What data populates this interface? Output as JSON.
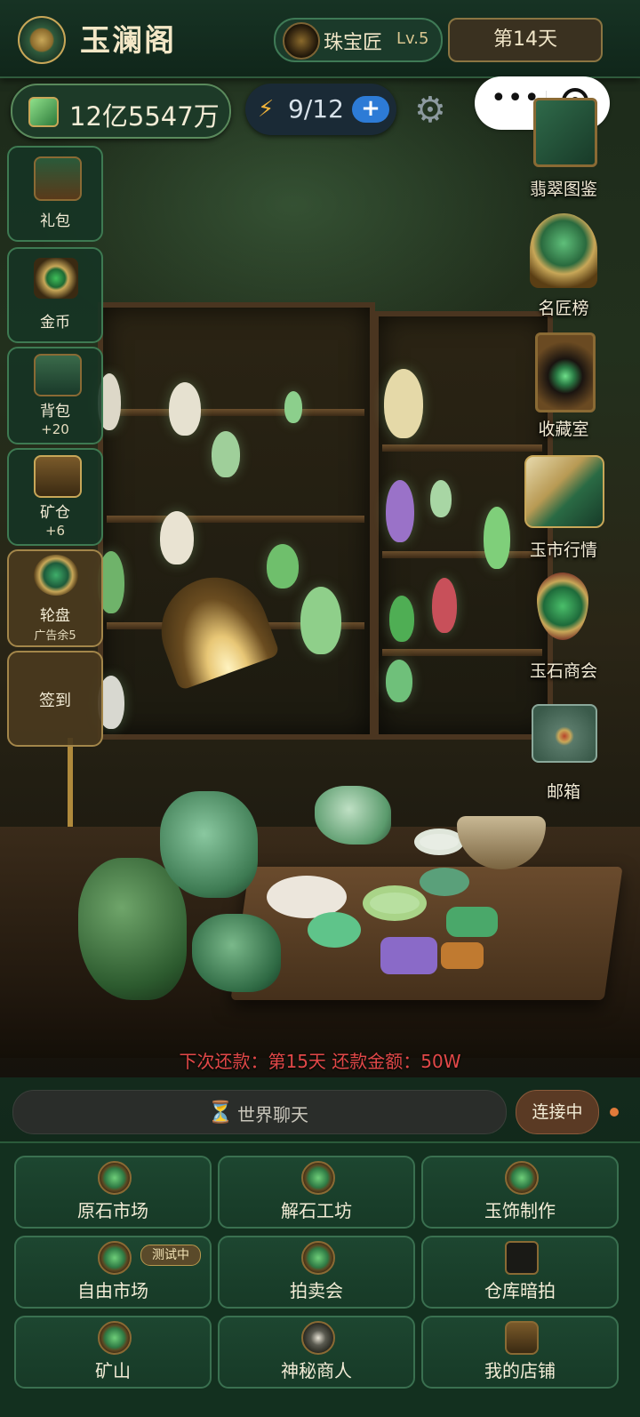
{
  "header": {
    "app_title": "玉澜阁",
    "rank_title": "珠宝匠",
    "rank_level": "Lv.5",
    "day_label": "第14天"
  },
  "resources": {
    "money": "12亿5547万",
    "energy": "9/12",
    "energy_add_symbol": "+"
  },
  "left_sidebar": [
    {
      "label": "礼包",
      "sub": ""
    },
    {
      "label": "金币",
      "sub": ""
    },
    {
      "label": "背包",
      "sub": "+20"
    },
    {
      "label": "矿仓",
      "sub": "+6"
    },
    {
      "label": "轮盘",
      "sub": "广告余5"
    },
    {
      "label": "签到",
      "sub": ""
    }
  ],
  "right_sidebar": [
    {
      "label": "翡翠图鉴",
      "icon": "jade-catalog-icon"
    },
    {
      "label": "名匠榜",
      "icon": "trophy-icon"
    },
    {
      "label": "收藏室",
      "icon": "collection-cabinet-icon"
    },
    {
      "label": "玉市行情",
      "icon": "market-chart-icon"
    },
    {
      "label": "玉石商会",
      "icon": "jade-pendant-icon"
    },
    {
      "label": "邮箱",
      "icon": "mail-envelope-icon"
    }
  ],
  "notice": "下次还款：第15天 还款金额：50W",
  "chat": {
    "label": "世界聊天",
    "connect_label": "连接中"
  },
  "main_menu": [
    {
      "label": "原石市场",
      "badge": ""
    },
    {
      "label": "解石工坊",
      "badge": ""
    },
    {
      "label": "玉饰制作",
      "badge": ""
    },
    {
      "label": "自由市场",
      "badge": "测试中"
    },
    {
      "label": "拍卖会",
      "badge": ""
    },
    {
      "label": "仓库暗拍",
      "badge": ""
    },
    {
      "label": "矿山",
      "badge": ""
    },
    {
      "label": "神秘商人",
      "badge": ""
    },
    {
      "label": "我的店铺",
      "badge": ""
    }
  ],
  "colors": {
    "panel_green": "#173a27",
    "gold_border": "#a3864a",
    "notice_red": "#e24848",
    "energy_blue": "#2d7bd6"
  }
}
